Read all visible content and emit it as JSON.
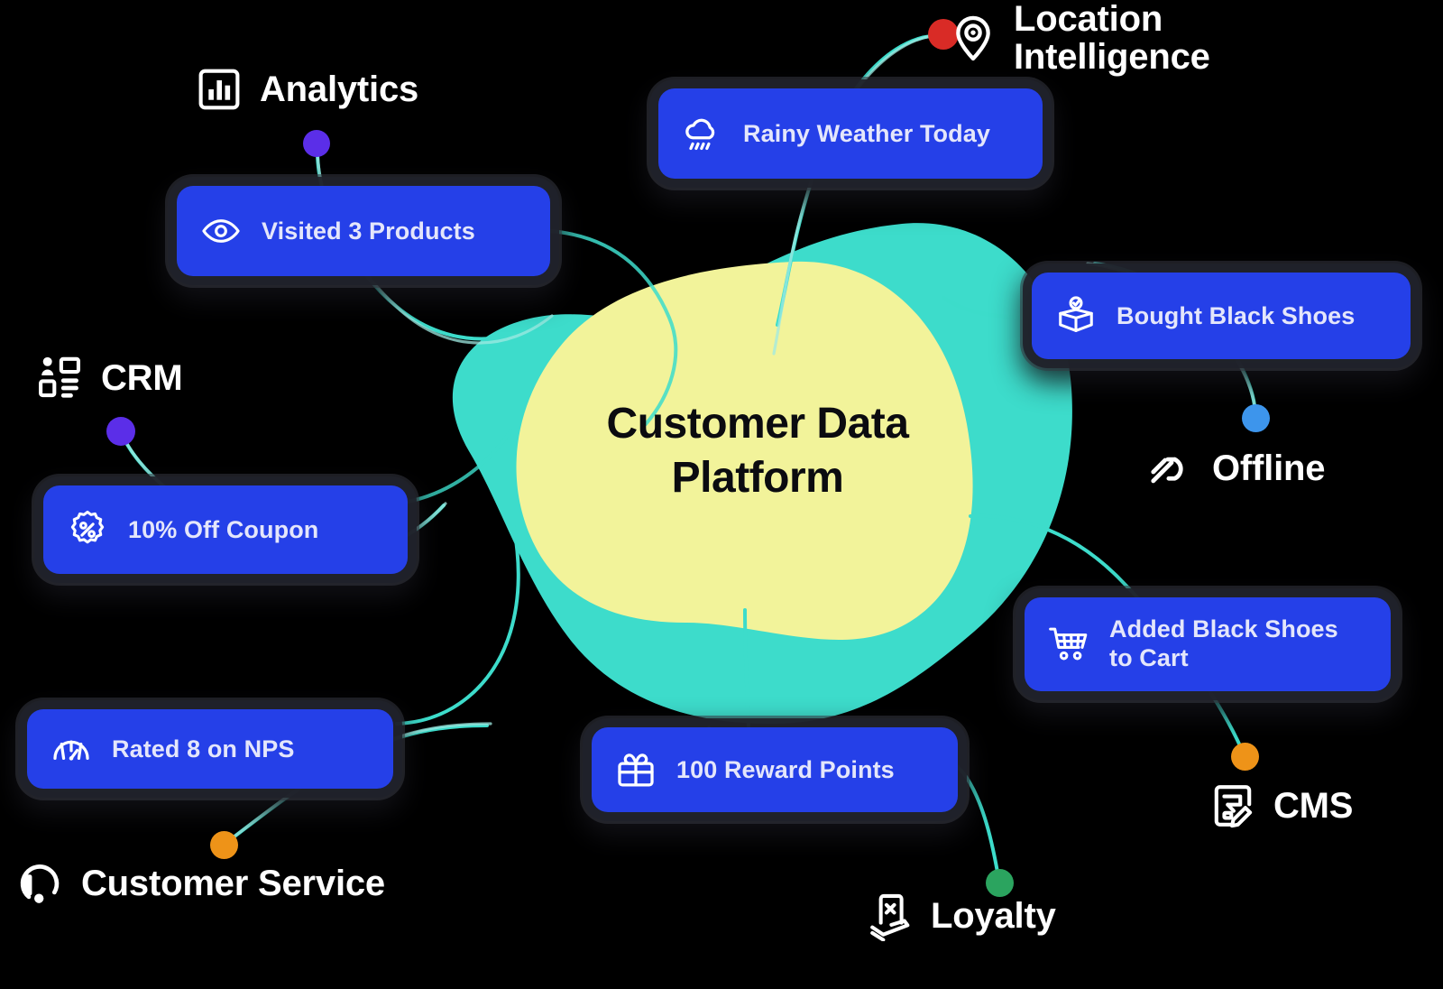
{
  "center": {
    "title_line1": "Customer Data",
    "title_line2": "Platform",
    "title": "Customer Data Platform"
  },
  "colors": {
    "background": "#000000",
    "card_blue": "#2540e8",
    "card_text": "#e4e6fb",
    "blob_yellow": "#f2f39a",
    "blob_teal": "#3ddccb",
    "connector_teal": "#3ddccb",
    "label_white": "#ffffff",
    "dot_purple": "#5b2ee8",
    "dot_red": "#d92b26",
    "dot_blue": "#3d95ec",
    "dot_orange": "#ee9318",
    "dot_green": "#2ba45f",
    "card_shadow": "#20222a"
  },
  "cards": [
    {
      "id": "visited",
      "label": "Visited 3 Products",
      "icon": "eye-icon"
    },
    {
      "id": "rainy",
      "label": "Rainy Weather Today",
      "icon": "rain-cloud-icon"
    },
    {
      "id": "bought",
      "label": "Bought Black Shoes",
      "icon": "package-check-icon"
    },
    {
      "id": "coupon",
      "label": "10% Off Coupon",
      "icon": "discount-badge-icon"
    },
    {
      "id": "cart",
      "label": "Added Black Shoes\nto Cart",
      "icon": "shopping-cart-icon"
    },
    {
      "id": "nps",
      "label": "Rated 8 on NPS",
      "icon": "gauge-icon"
    },
    {
      "id": "reward",
      "label": "100 Reward Points",
      "icon": "gift-icon"
    }
  ],
  "sources": [
    {
      "id": "analytics",
      "label": "Analytics",
      "icon": "bar-chart-icon",
      "dot_color": "#5b2ee8"
    },
    {
      "id": "location",
      "label": "Location\nIntelligence",
      "icon": "map-pin-icon",
      "dot_color": "#d92b26"
    },
    {
      "id": "crm",
      "label": "CRM",
      "icon": "contacts-icon",
      "dot_color": "#5b2ee8"
    },
    {
      "id": "offline",
      "label": "Offline",
      "icon": "offline-slash-icon",
      "dot_color": "#3d95ec"
    },
    {
      "id": "cms",
      "label": "CMS",
      "icon": "cms-doc-icon",
      "dot_color": "#ee9318"
    },
    {
      "id": "loyalty",
      "label": "Loyalty",
      "icon": "loyalty-card-icon",
      "dot_color": "#2ba45f"
    },
    {
      "id": "service",
      "label": "Customer Service",
      "icon": "headset-icon",
      "dot_color": "#ee9318"
    }
  ],
  "chart_data": {
    "type": "diagram",
    "title": "Customer Data Platform",
    "hub": "Customer Data Platform",
    "nodes": [
      {
        "name": "Visited 3 Products",
        "type": "event",
        "source": "Analytics"
      },
      {
        "name": "Rainy Weather Today",
        "type": "event",
        "source": "Location Intelligence"
      },
      {
        "name": "Bought Black Shoes",
        "type": "event",
        "source": "Offline"
      },
      {
        "name": "10% Off Coupon",
        "type": "event",
        "source": "CRM"
      },
      {
        "name": "Added Black Shoes to Cart",
        "type": "event",
        "source": "CMS"
      },
      {
        "name": "Rated 8 on NPS",
        "type": "event",
        "source": "Customer Service"
      },
      {
        "name": "100 Reward Points",
        "type": "event",
        "source": "Loyalty"
      },
      {
        "name": "Analytics",
        "type": "source"
      },
      {
        "name": "Location Intelligence",
        "type": "source"
      },
      {
        "name": "CRM",
        "type": "source"
      },
      {
        "name": "Offline",
        "type": "source"
      },
      {
        "name": "CMS",
        "type": "source"
      },
      {
        "name": "Loyalty",
        "type": "source"
      },
      {
        "name": "Customer Service",
        "type": "source"
      }
    ],
    "edges": [
      {
        "from": "Analytics",
        "to": "Visited 3 Products"
      },
      {
        "from": "Location Intelligence",
        "to": "Rainy Weather Today"
      },
      {
        "from": "Offline",
        "to": "Bought Black Shoes"
      },
      {
        "from": "CRM",
        "to": "10% Off Coupon"
      },
      {
        "from": "CMS",
        "to": "Added Black Shoes to Cart"
      },
      {
        "from": "Customer Service",
        "to": "Rated 8 on NPS"
      },
      {
        "from": "Loyalty",
        "to": "100 Reward Points"
      },
      {
        "from": "Visited 3 Products",
        "to": "Customer Data Platform"
      },
      {
        "from": "Rainy Weather Today",
        "to": "Customer Data Platform"
      },
      {
        "from": "Bought Black Shoes",
        "to": "Customer Data Platform"
      },
      {
        "from": "10% Off Coupon",
        "to": "Customer Data Platform"
      },
      {
        "from": "Added Black Shoes to Cart",
        "to": "Customer Data Platform"
      },
      {
        "from": "Rated 8 on NPS",
        "to": "Customer Data Platform"
      },
      {
        "from": "100 Reward Points",
        "to": "Customer Data Platform"
      }
    ]
  }
}
